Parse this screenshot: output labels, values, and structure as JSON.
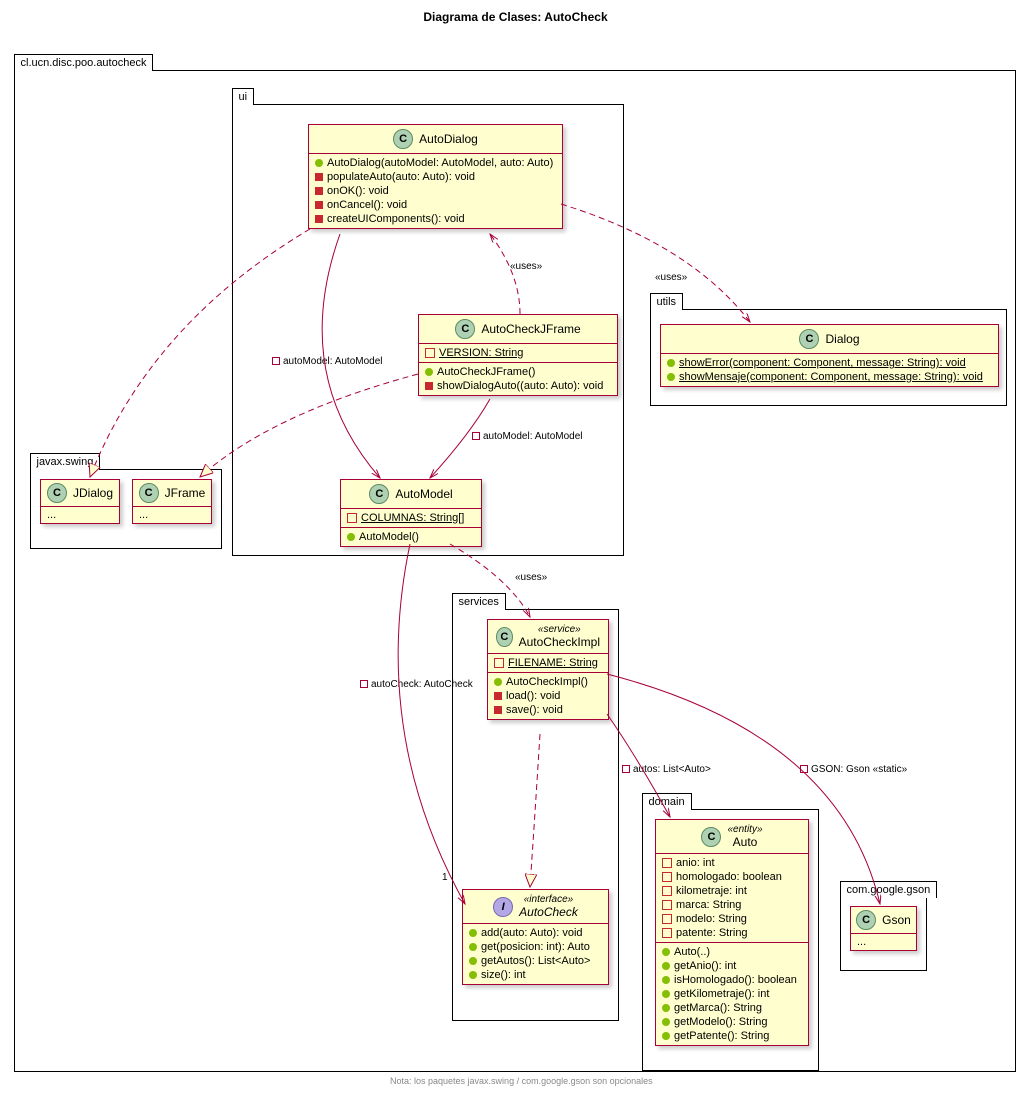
{
  "title": "Diagrama de Clases: AutoCheck",
  "note": "Nota: los paquetes javax.swing / com.google.gson son opcionales",
  "packages": {
    "root": "cl.ucn.disc.poo.autocheck",
    "ui": "ui",
    "utils": "utils",
    "swing": "javax.swing",
    "services": "services",
    "domain": "domain",
    "gson": "com.google.gson"
  },
  "classes": {
    "AutoDialog": {
      "name": "AutoDialog",
      "stereotype": null,
      "icon": "C",
      "attributes": [],
      "methods": [
        {
          "vis": "public",
          "static": false,
          "text": "AutoDialog(autoModel: AutoModel, auto: Auto)"
        },
        {
          "vis": "private",
          "static": false,
          "text": "populateAuto(auto: Auto): void"
        },
        {
          "vis": "private",
          "static": false,
          "text": "onOK(): void"
        },
        {
          "vis": "private",
          "static": false,
          "text": "onCancel(): void"
        },
        {
          "vis": "private",
          "static": false,
          "text": "createUIComponents(): void"
        }
      ]
    },
    "AutoCheckJFrame": {
      "name": "AutoCheckJFrame",
      "stereotype": null,
      "icon": "C",
      "attributes": [
        {
          "vis": "package-sq",
          "static": true,
          "text": "VERSION: String"
        }
      ],
      "methods": [
        {
          "vis": "public",
          "static": false,
          "text": "AutoCheckJFrame()"
        },
        {
          "vis": "private",
          "static": false,
          "text": "showDialogAuto((auto: Auto): void"
        }
      ]
    },
    "AutoModel": {
      "name": "AutoModel",
      "stereotype": null,
      "icon": "C",
      "attributes": [
        {
          "vis": "package-sq",
          "static": true,
          "text": "COLUMNAS: String[]"
        }
      ],
      "methods": [
        {
          "vis": "public",
          "static": false,
          "text": "AutoModel()"
        }
      ]
    },
    "Dialog": {
      "name": "Dialog",
      "stereotype": null,
      "icon": "C",
      "attributes": [],
      "methods": [
        {
          "vis": "public",
          "static": true,
          "text": "showError(component: Component, message: String): void"
        },
        {
          "vis": "public",
          "static": true,
          "text": "showMensaje(component: Component, message: String): void"
        }
      ]
    },
    "JDialog": {
      "name": "JDialog",
      "icon": "C",
      "ellipsis": "..."
    },
    "JFrame": {
      "name": "JFrame",
      "icon": "C",
      "ellipsis": "..."
    },
    "AutoCheckImpl": {
      "name": "AutoCheckImpl",
      "stereotype": "«service»",
      "icon": "C",
      "attributes": [
        {
          "vis": "package-sq",
          "static": true,
          "text": "FILENAME: String"
        }
      ],
      "methods": [
        {
          "vis": "public",
          "static": false,
          "text": "AutoCheckImpl()"
        },
        {
          "vis": "private",
          "static": false,
          "text": "load(): void"
        },
        {
          "vis": "private",
          "static": false,
          "text": "save(): void"
        }
      ]
    },
    "AutoCheck": {
      "name": "AutoCheck",
      "stereotype": "«interface»",
      "icon": "I",
      "attributes": [],
      "methods": [
        {
          "vis": "public",
          "static": false,
          "text": "add(auto: Auto): void"
        },
        {
          "vis": "public",
          "static": false,
          "text": "get(posicion: int): Auto"
        },
        {
          "vis": "public",
          "static": false,
          "text": "getAutos(): List<Auto>"
        },
        {
          "vis": "public",
          "static": false,
          "text": "size(): int"
        }
      ]
    },
    "Auto": {
      "name": "Auto",
      "stereotype": "«entity»",
      "icon": "C",
      "attributes": [
        {
          "vis": "package-sq",
          "static": false,
          "text": "anio: int"
        },
        {
          "vis": "package-sq",
          "static": false,
          "text": "homologado: boolean"
        },
        {
          "vis": "package-sq",
          "static": false,
          "text": "kilometraje: int"
        },
        {
          "vis": "package-sq",
          "static": false,
          "text": "marca: String"
        },
        {
          "vis": "package-sq",
          "static": false,
          "text": "modelo: String"
        },
        {
          "vis": "package-sq",
          "static": false,
          "text": "patente: String"
        }
      ],
      "methods": [
        {
          "vis": "public",
          "static": false,
          "text": "Auto(..)"
        },
        {
          "vis": "public",
          "static": false,
          "text": "getAnio(): int"
        },
        {
          "vis": "public",
          "static": false,
          "text": "isHomologado(): boolean"
        },
        {
          "vis": "public",
          "static": false,
          "text": "getKilometraje(): int"
        },
        {
          "vis": "public",
          "static": false,
          "text": "getMarca(): String"
        },
        {
          "vis": "public",
          "static": false,
          "text": "getModelo(): String"
        },
        {
          "vis": "public",
          "static": false,
          "text": "getPatente(): String"
        }
      ]
    },
    "Gson": {
      "name": "Gson",
      "icon": "C",
      "ellipsis": "..."
    }
  },
  "edge_labels": {
    "uses1": "«uses»",
    "uses2": "«uses»",
    "uses3": "«uses»",
    "autoModel1": "autoModel: AutoModel",
    "autoModel2": "autoModel: AutoModel",
    "autoCheck": "autoCheck: AutoCheck",
    "autos": "autos: List<Auto>",
    "gson": "GSON: Gson «static»",
    "one": "1"
  }
}
